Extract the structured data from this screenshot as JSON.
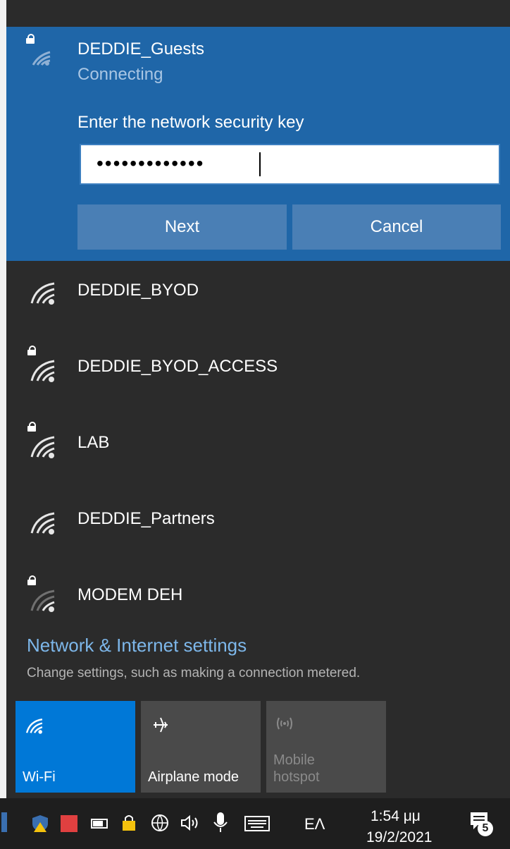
{
  "active_network": {
    "name": "DEDDIE_Guests",
    "status": "Connecting",
    "key_label": "Enter the network security key",
    "key_value": "•••••••••••••",
    "next_label": "Next",
    "cancel_label": "Cancel"
  },
  "networks": [
    {
      "name": "DEDDIE_BYOD",
      "secured": false
    },
    {
      "name": "DEDDIE_BYOD_ACCESS",
      "secured": true
    },
    {
      "name": "LAB",
      "secured": true
    },
    {
      "name": "DEDDIE_Partners",
      "secured": false
    },
    {
      "name": "MODEM DEH",
      "secured": true
    }
  ],
  "settings": {
    "link": "Network & Internet settings",
    "description": "Change settings, such as making a connection metered."
  },
  "quick_actions": {
    "wifi": "Wi-Fi",
    "airplane": "Airplane mode",
    "hotspot_line1": "Mobile",
    "hotspot_line2": "hotspot"
  },
  "taskbar": {
    "language": "ΕΛ",
    "time": "1:54 μμ",
    "date": "19/2/2021",
    "notification_count": "5"
  },
  "colors": {
    "accent": "#0078d7",
    "active_bg": "#1f66a8",
    "panel_bg": "#2b2b2b",
    "link": "#7db7ea"
  }
}
